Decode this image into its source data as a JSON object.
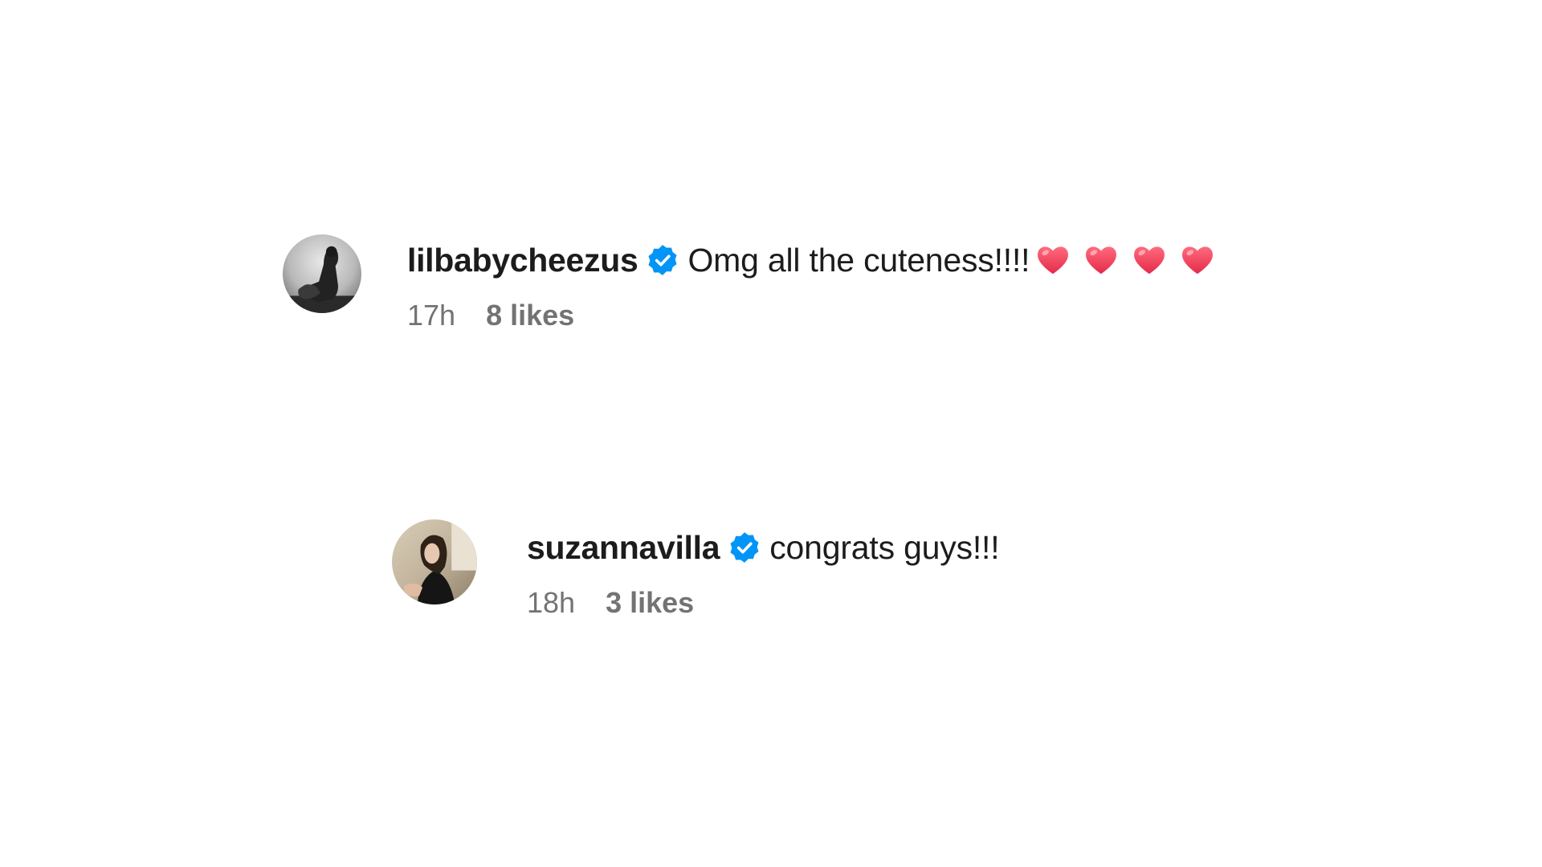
{
  "comments": [
    {
      "username": "lilbabycheezus",
      "verified": true,
      "text": "Omg all the cuteness!!!!",
      "emoji": [
        "heart",
        "heart",
        "heart",
        "heart"
      ],
      "time": "17h",
      "likes": "8 likes"
    },
    {
      "username": "suzannavilla",
      "verified": true,
      "text": "congrats guys!!!",
      "time": "18h",
      "likes": "3 likes"
    }
  ],
  "colors": {
    "verified_badge": "#0095f6",
    "heart": "#f0405a",
    "meta_text": "#737373",
    "primary_text": "#1c1c1c"
  }
}
